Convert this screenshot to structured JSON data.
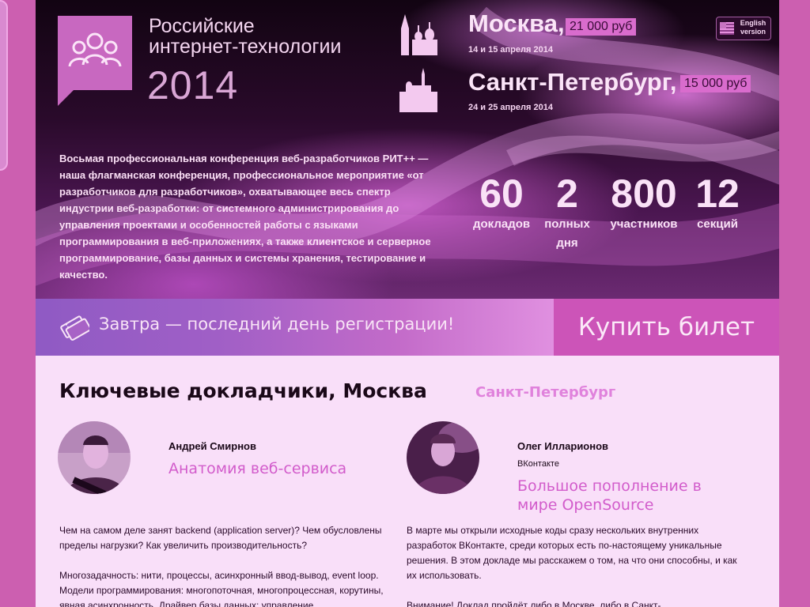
{
  "header": {
    "title_line1": "Российские",
    "title_line2": "интернет-технологии",
    "year": "2014",
    "english_link": "English version"
  },
  "cities": [
    {
      "name": "Москва,",
      "price": "21 000 руб",
      "dates": "14 и 15 апреля 2014"
    },
    {
      "name": "Санкт-Петербург,",
      "price": "15 000 руб",
      "dates": "24 и 25 апреля 2014"
    }
  ],
  "description": "Восьмая профессиональная конференция веб-разработчиков РИТ++ — наша флагманская конференция, профессиональное мероприятие «от разработчиков для разработчиков», охватывающее весь спектр индустрии веб-разработки: от системного администрирования до управления проектами и особенностей работы с языками программирования в веб-приложениях, а также клиентское и серверное программирование, базы данных и системы хранения, тестирование и качество.",
  "stats": [
    {
      "value": "60",
      "label": "докладов"
    },
    {
      "value": "2",
      "label": "полных дня"
    },
    {
      "value": "800",
      "label": "участников"
    },
    {
      "value": "12",
      "label": "секций"
    }
  ],
  "registration": {
    "text": "Завтра — последний день регистрации!",
    "buy_label": "Купить билет"
  },
  "speakers_section": {
    "title": "Ключевые докладчики, Москва",
    "other_city": "Санкт-Петербург"
  },
  "speakers": [
    {
      "name": "Андрей Смирнов",
      "company": "",
      "talk": "Анатомия веб-сервиса",
      "text1": "Чем на самом деле занят backend (application server)? Чем обусловлены пределы нагрузки? Как увеличить производительность?",
      "text2": "Многозадачность: нити, процессы, асинхронный ввод-вывод, event loop. Модели программирования: многопоточная, многопроцессная, корутины, явная асинхронность. Драйвер базы данных: управление"
    },
    {
      "name": "Олег Илларионов",
      "company": "ВКонтакте",
      "talk": "Большое пополнение в мире OpenSource",
      "text1": "В марте мы открыли исходные коды сразу нескольких внутренних разработок ВКонтакте, среди которых есть по-настоящему уникальные решения. В этом докладе мы расскажем о том, на что они способны, и как их использовать.",
      "text2": "Внимание! Доклад пройдёт либо в Москве, либо в Санкт-"
    }
  ],
  "colors": {
    "accent": "#cc54b8",
    "page_bg": "#cc5fb0",
    "content_bg": "#f9dff9",
    "talk_title": "#d25ccb"
  }
}
